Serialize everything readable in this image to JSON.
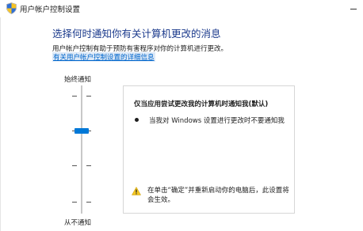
{
  "window": {
    "title": "用户帐户控制设置",
    "icon": "uac-shield-icon",
    "minimize_icon": "minimize-icon"
  },
  "main": {
    "heading": "选择何时通知你有关计算机更改的消息",
    "description": "用户帐户控制有助于预防有害程序对你的计算机进行更改。",
    "help_link": "有关用户帐户控制设置的详细信息"
  },
  "slider": {
    "top_label": "始终通知",
    "bottom_label": "从不通知",
    "level_count": 4,
    "selected_level": 3
  },
  "info": {
    "title": "仅当应用尝试更改我的计算机时通知我(默认)",
    "bullets": [
      "当我对 Windows 设置进行更改时不要通知我"
    ],
    "warning": "在单击“确定”并重新启动你的电脑后，此设置将会生效。",
    "warning_icon": "warning-icon"
  },
  "colors": {
    "heading": "#1b3a8c",
    "link": "#0066cc",
    "accent": "#0078d7",
    "warning": "#f3c623"
  }
}
